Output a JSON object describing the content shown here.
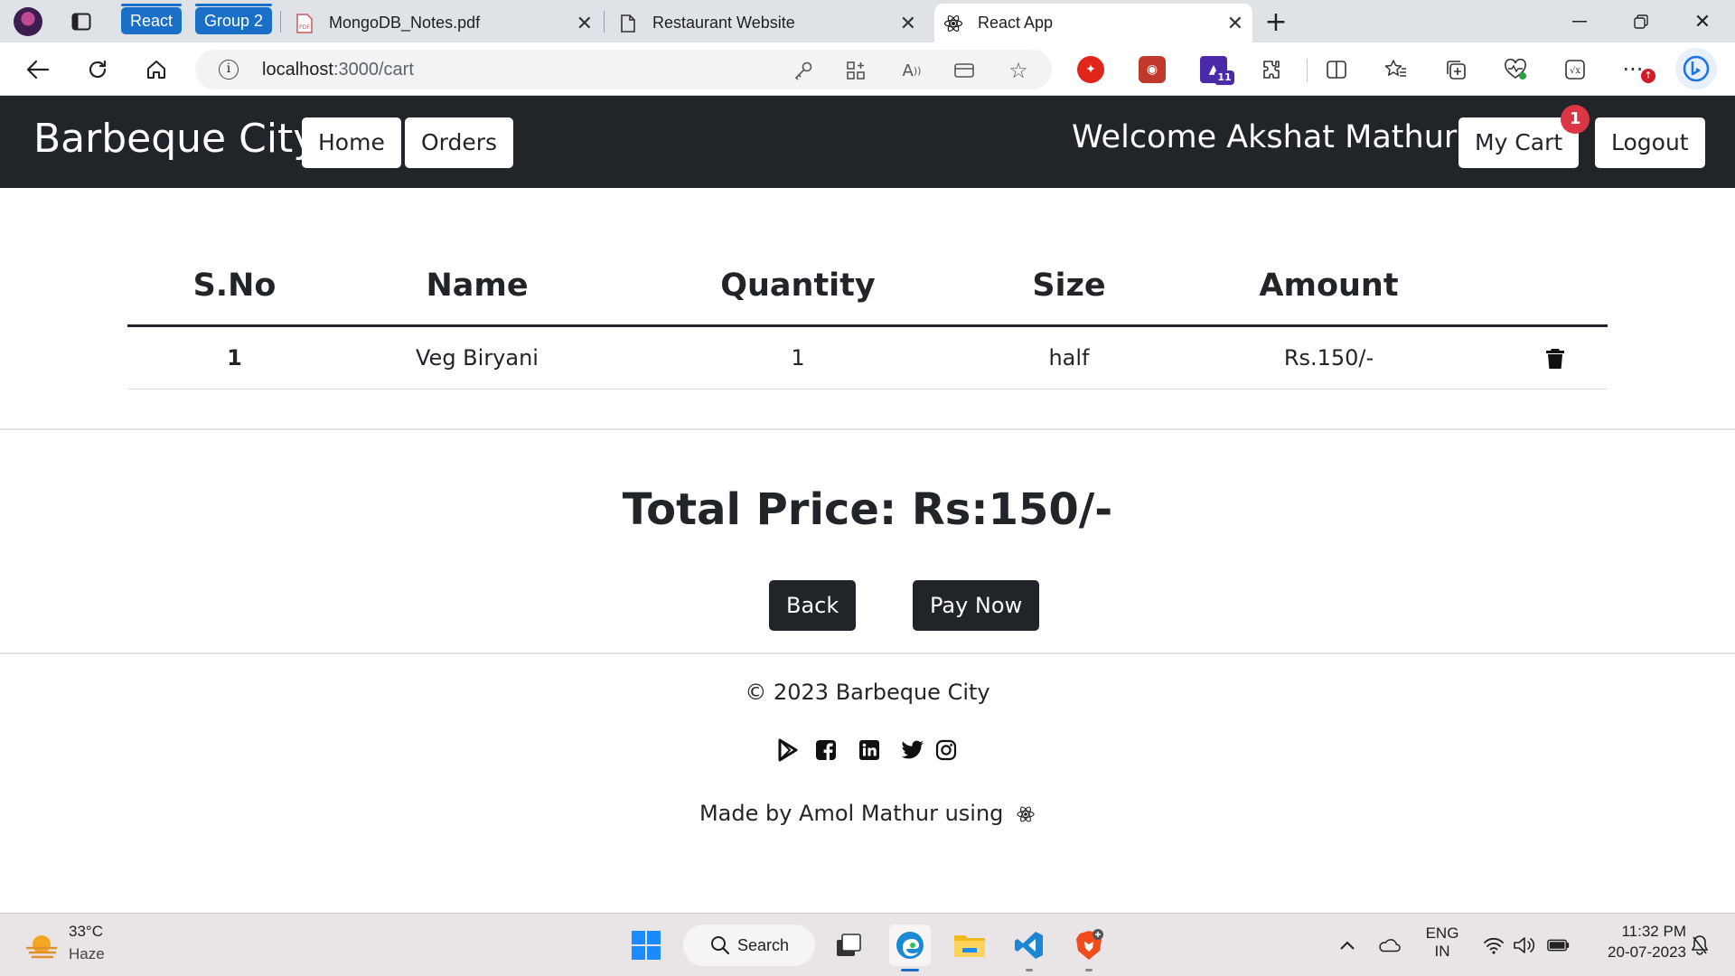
{
  "browser": {
    "tab_groups": [
      "React",
      "Group 2"
    ],
    "tabs": [
      {
        "title": "MongoDB_Notes.pdf"
      },
      {
        "title": "Restaurant Website"
      },
      {
        "title": "React App"
      }
    ],
    "new_tab_label": "+",
    "url_host": "localhost",
    "url_path": ":3000/cart",
    "extension_badge_count": "11"
  },
  "navbar": {
    "brand": "Barbeque City",
    "home_label": "Home",
    "orders_label": "Orders",
    "welcome_text": "Welcome Akshat Mathur",
    "cart_label": "My Cart",
    "cart_count": "1",
    "logout_label": "Logout"
  },
  "cart": {
    "headers": {
      "sno": "S.No",
      "name": "Name",
      "quantity": "Quantity",
      "size": "Size",
      "amount": "Amount"
    },
    "rows": [
      {
        "sno": "1",
        "name": "Veg Biryani",
        "quantity": "1",
        "size": "half",
        "amount": "Rs.150/-"
      }
    ],
    "total_text": "Total Price: Rs:150/-",
    "back_label": "Back",
    "pay_label": "Pay Now"
  },
  "footer": {
    "copyright": "© 2023 Barbeque City",
    "made_by": "Made by Amol Mathur using"
  },
  "taskbar": {
    "weather_temp": "33°C",
    "weather_desc": "Haze",
    "search_label": "Search",
    "lang_top": "ENG",
    "lang_bottom": "IN",
    "time": "11:32 PM",
    "date": "20-07-2023"
  },
  "colors": {
    "navbar_bg": "#212529",
    "badge_red": "#dc3545",
    "tab_group_blue": "#1a6fc9"
  }
}
